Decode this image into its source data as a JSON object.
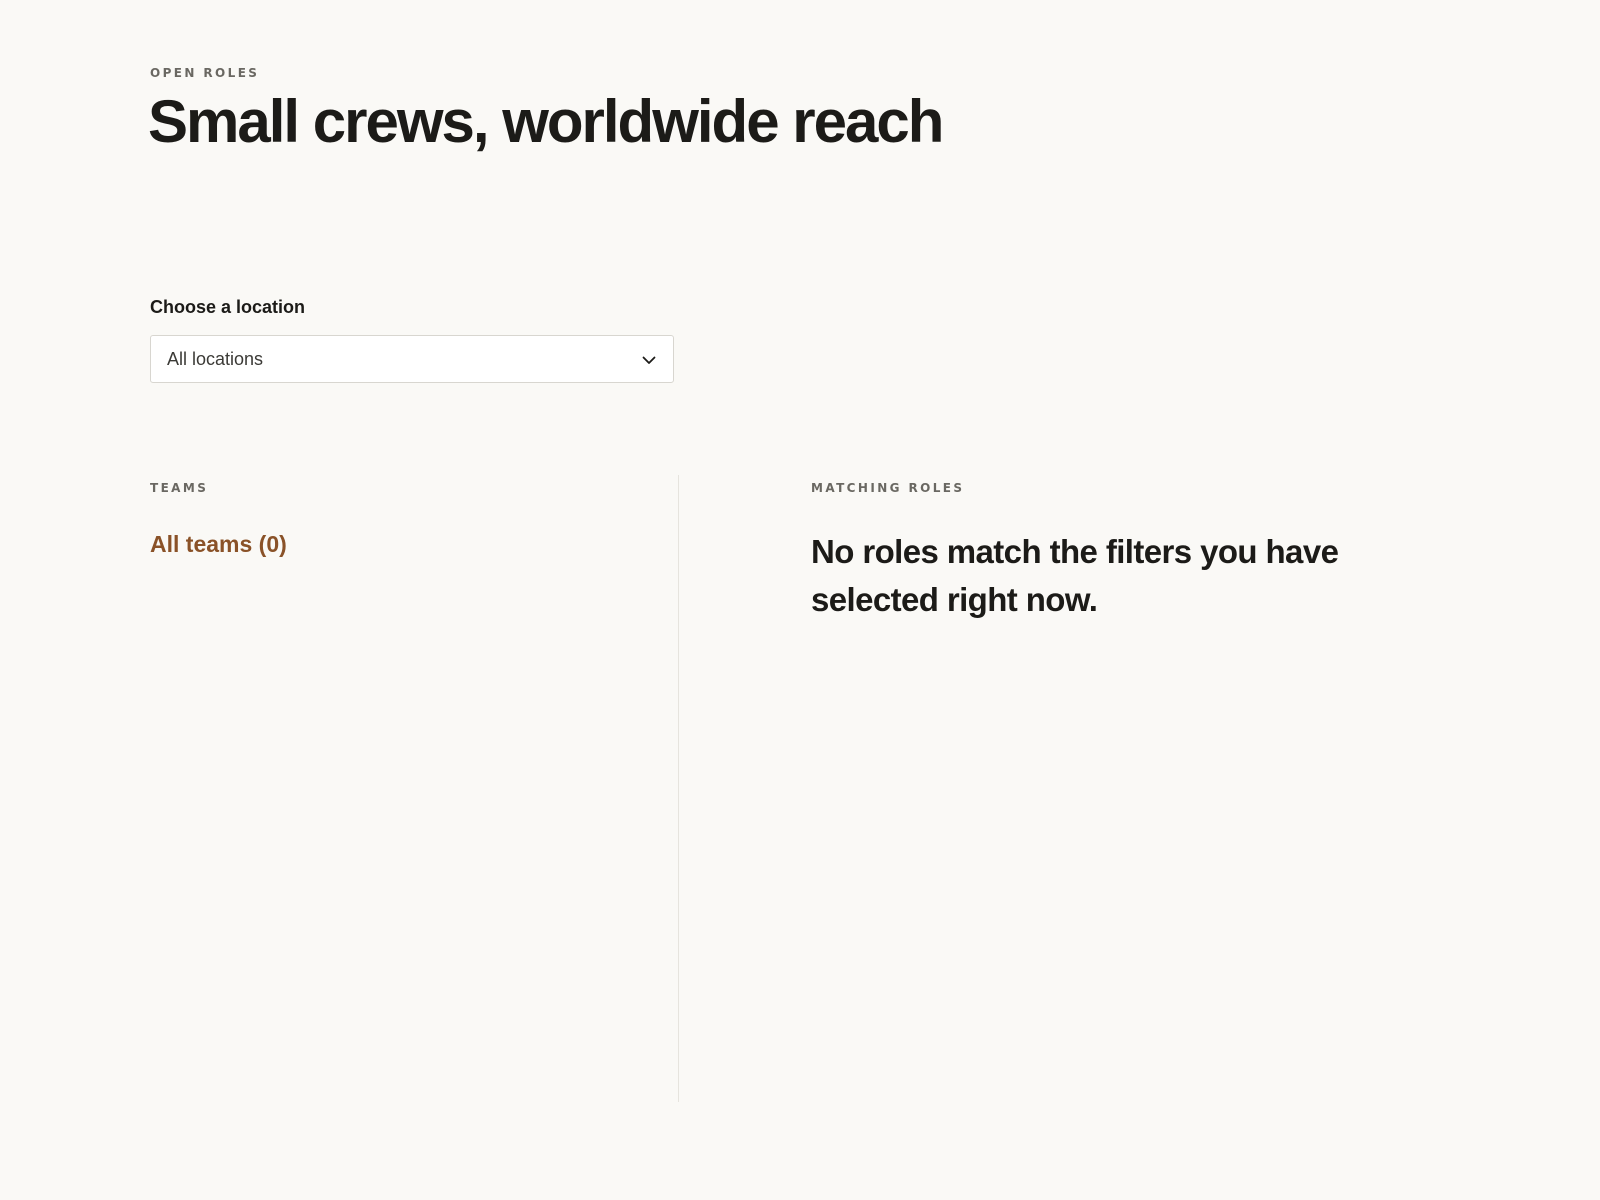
{
  "header": {
    "eyebrow": "OPEN ROLES",
    "title": "Small crews, worldwide reach"
  },
  "filter": {
    "label": "Choose a location",
    "selected_value": "All locations",
    "icon": "chevron-down-icon"
  },
  "teams": {
    "heading": "TEAMS",
    "items": [
      {
        "label": "All teams (0)"
      }
    ]
  },
  "roles": {
    "heading": "MATCHING ROLES",
    "empty_message": "No roles match the filters you have selected right now."
  },
  "colors": {
    "background": "#faf9f6",
    "text": "#1c1b18",
    "muted": "#6a6862",
    "accent": "#8a5228",
    "border": "#d8d6d0",
    "divider": "#e6e4de"
  }
}
